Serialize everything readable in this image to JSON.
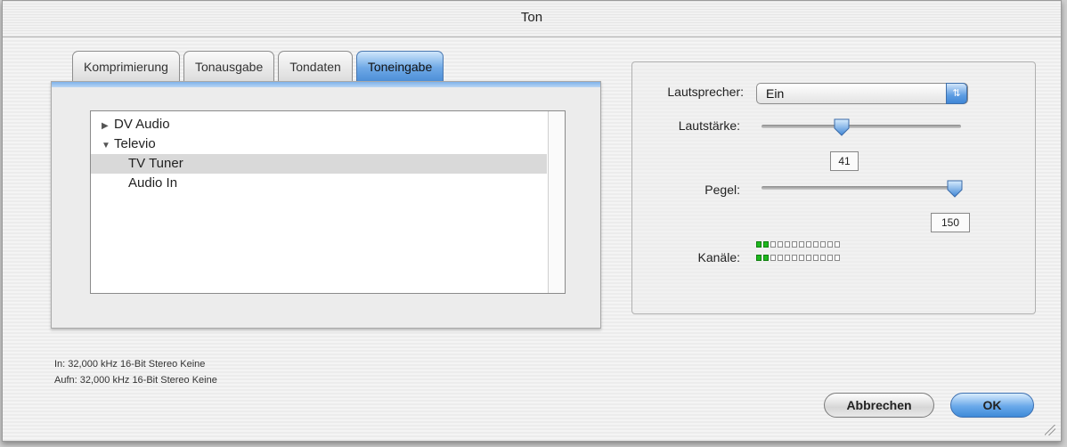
{
  "window": {
    "title": "Ton"
  },
  "tabs": [
    {
      "label": "Komprimierung",
      "active": false
    },
    {
      "label": "Tonausgabe",
      "active": false
    },
    {
      "label": "Tondaten",
      "active": false
    },
    {
      "label": "Toneingabe",
      "active": true
    }
  ],
  "source_list": {
    "items": [
      {
        "label": "DV Audio",
        "disclosure": "collapsed",
        "level": 0,
        "selected": false
      },
      {
        "label": "Televio",
        "disclosure": "expanded",
        "level": 0,
        "selected": false
      },
      {
        "label": "TV Tuner",
        "level": 1,
        "selected": true
      },
      {
        "label": "Audio In",
        "level": 1,
        "selected": false
      }
    ]
  },
  "info": {
    "line1": "In: 32,000 kHz 16-Bit Stereo Keine",
    "line2": "Aufn: 32,000 kHz 16-Bit Stereo Keine"
  },
  "settings": {
    "speaker_label": "Lautsprecher:",
    "speaker_value": "Ein",
    "volume_label": "Lautstärke:",
    "volume_value": "41",
    "gain_label": "Pegel:",
    "gain_value": "150",
    "channels_label": "Kanäle:",
    "channel_levels": [
      2,
      2
    ],
    "channel_segments": 12
  },
  "buttons": {
    "cancel": "Abbrechen",
    "ok": "OK"
  },
  "colors": {
    "accent": "#4d8fd8",
    "meter_on": "#1db81d"
  },
  "icons": {
    "speaker_select_arrow": "up-down-arrows-icon",
    "collapsed": "triangle-right-icon",
    "expanded": "triangle-down-icon"
  }
}
